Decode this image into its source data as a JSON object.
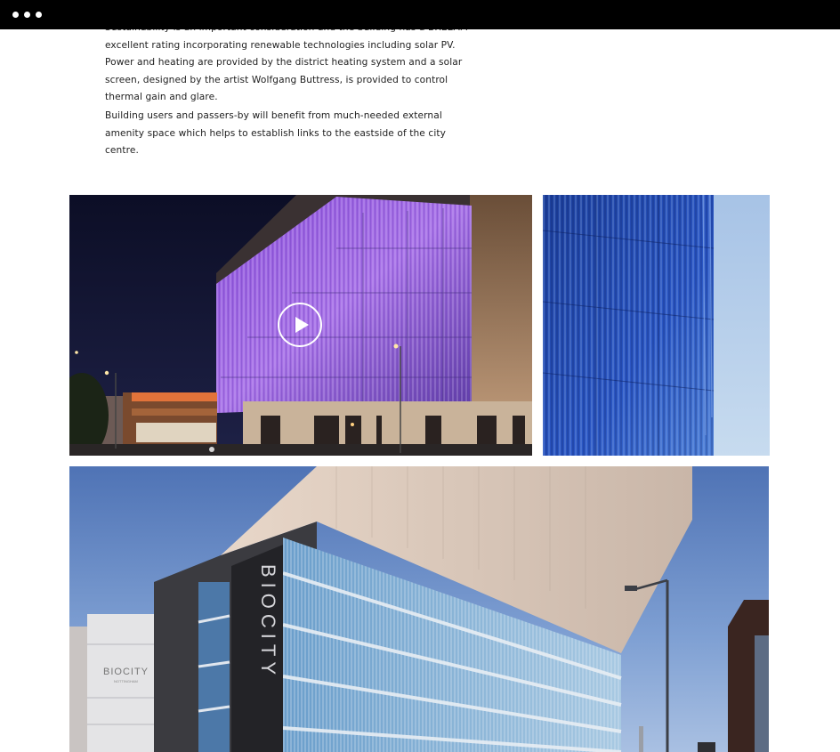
{
  "header": {
    "menu_icon": "ellipsis-menu-icon"
  },
  "article": {
    "paragraphs": [
      "Sustainability is an important consideration and the building has a BREEAM excellent rating incorporating renewable technologies including solar PV. Power and heating are provided by the district heating system and a solar screen, designed by the artist Wolfgang Buttress, is provided to control thermal gain and glare.",
      "Building users and passers-by will benefit from much-needed external amenity space which helps to establish links to the eastside of the city centre."
    ]
  },
  "gallery": {
    "video_play_icon": "play-icon",
    "building_sign": "BIOCITY",
    "side_building_sign": "BIOCITY",
    "side_building_subtitle": "NOTTINGHAM"
  },
  "colors": {
    "topbar": "#000000",
    "body_text": "#1e1e1e",
    "background": "#ffffff"
  }
}
